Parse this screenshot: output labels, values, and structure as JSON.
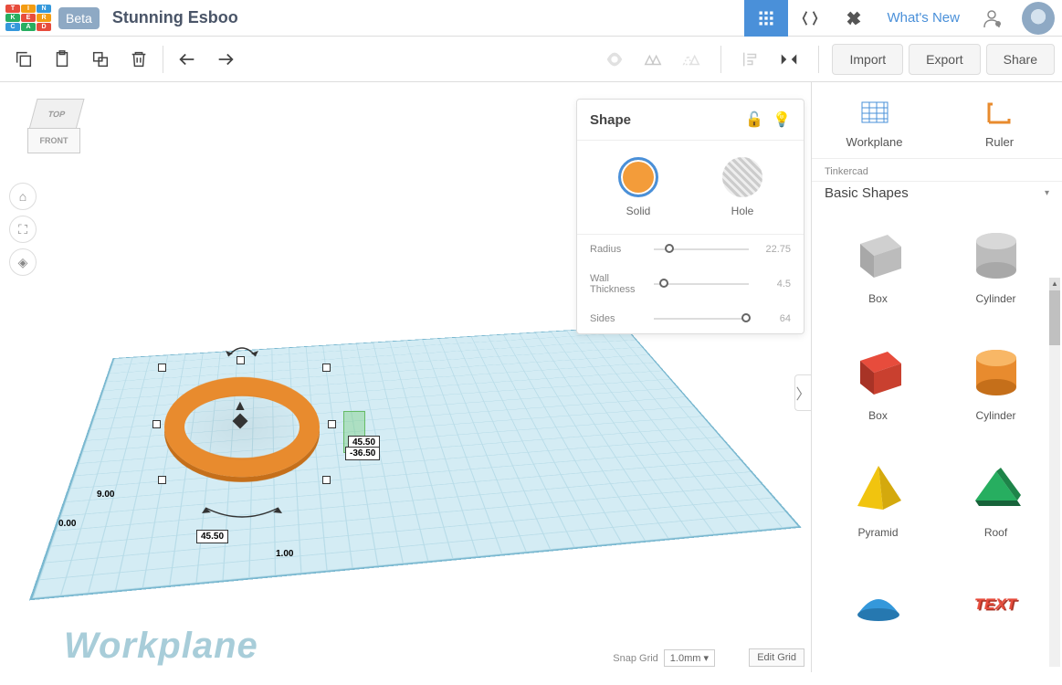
{
  "header": {
    "beta": "Beta",
    "project_title": "Stunning Esboo",
    "whats_new": "What's New"
  },
  "toolbar": {
    "import": "Import",
    "export": "Export",
    "share": "Share"
  },
  "viewcube": {
    "top": "TOP",
    "front": "FRONT"
  },
  "shape_panel": {
    "title": "Shape",
    "solid": "Solid",
    "hole": "Hole",
    "params": [
      {
        "name": "Radius",
        "value": "22.75",
        "pos": 12
      },
      {
        "name": "Wall Thickness",
        "value": "4.5",
        "pos": 6
      },
      {
        "name": "Sides",
        "value": "64",
        "pos": 92
      }
    ]
  },
  "dimensions": {
    "width": "45.50",
    "depth": "45.50",
    "neg_depth": "-36.50",
    "height": "9.00",
    "z": "0.00",
    "one": "1.00"
  },
  "sidebar": {
    "workplane": "Workplane",
    "ruler": "Ruler",
    "category_small": "Tinkercad",
    "category": "Basic Shapes",
    "shapes": [
      {
        "name": "Box",
        "kind": "box-gray"
      },
      {
        "name": "Cylinder",
        "kind": "cyl-gray"
      },
      {
        "name": "Box",
        "kind": "box-red"
      },
      {
        "name": "Cylinder",
        "kind": "cyl-orange"
      },
      {
        "name": "Pyramid",
        "kind": "pyramid"
      },
      {
        "name": "Roof",
        "kind": "roof"
      },
      {
        "name": "",
        "kind": "dome"
      },
      {
        "name": "",
        "kind": "text"
      }
    ]
  },
  "canvas": {
    "workplane_label": "Workplane",
    "edit_grid": "Edit Grid",
    "snap_grid": "Snap Grid",
    "snap_value": "1.0mm"
  }
}
